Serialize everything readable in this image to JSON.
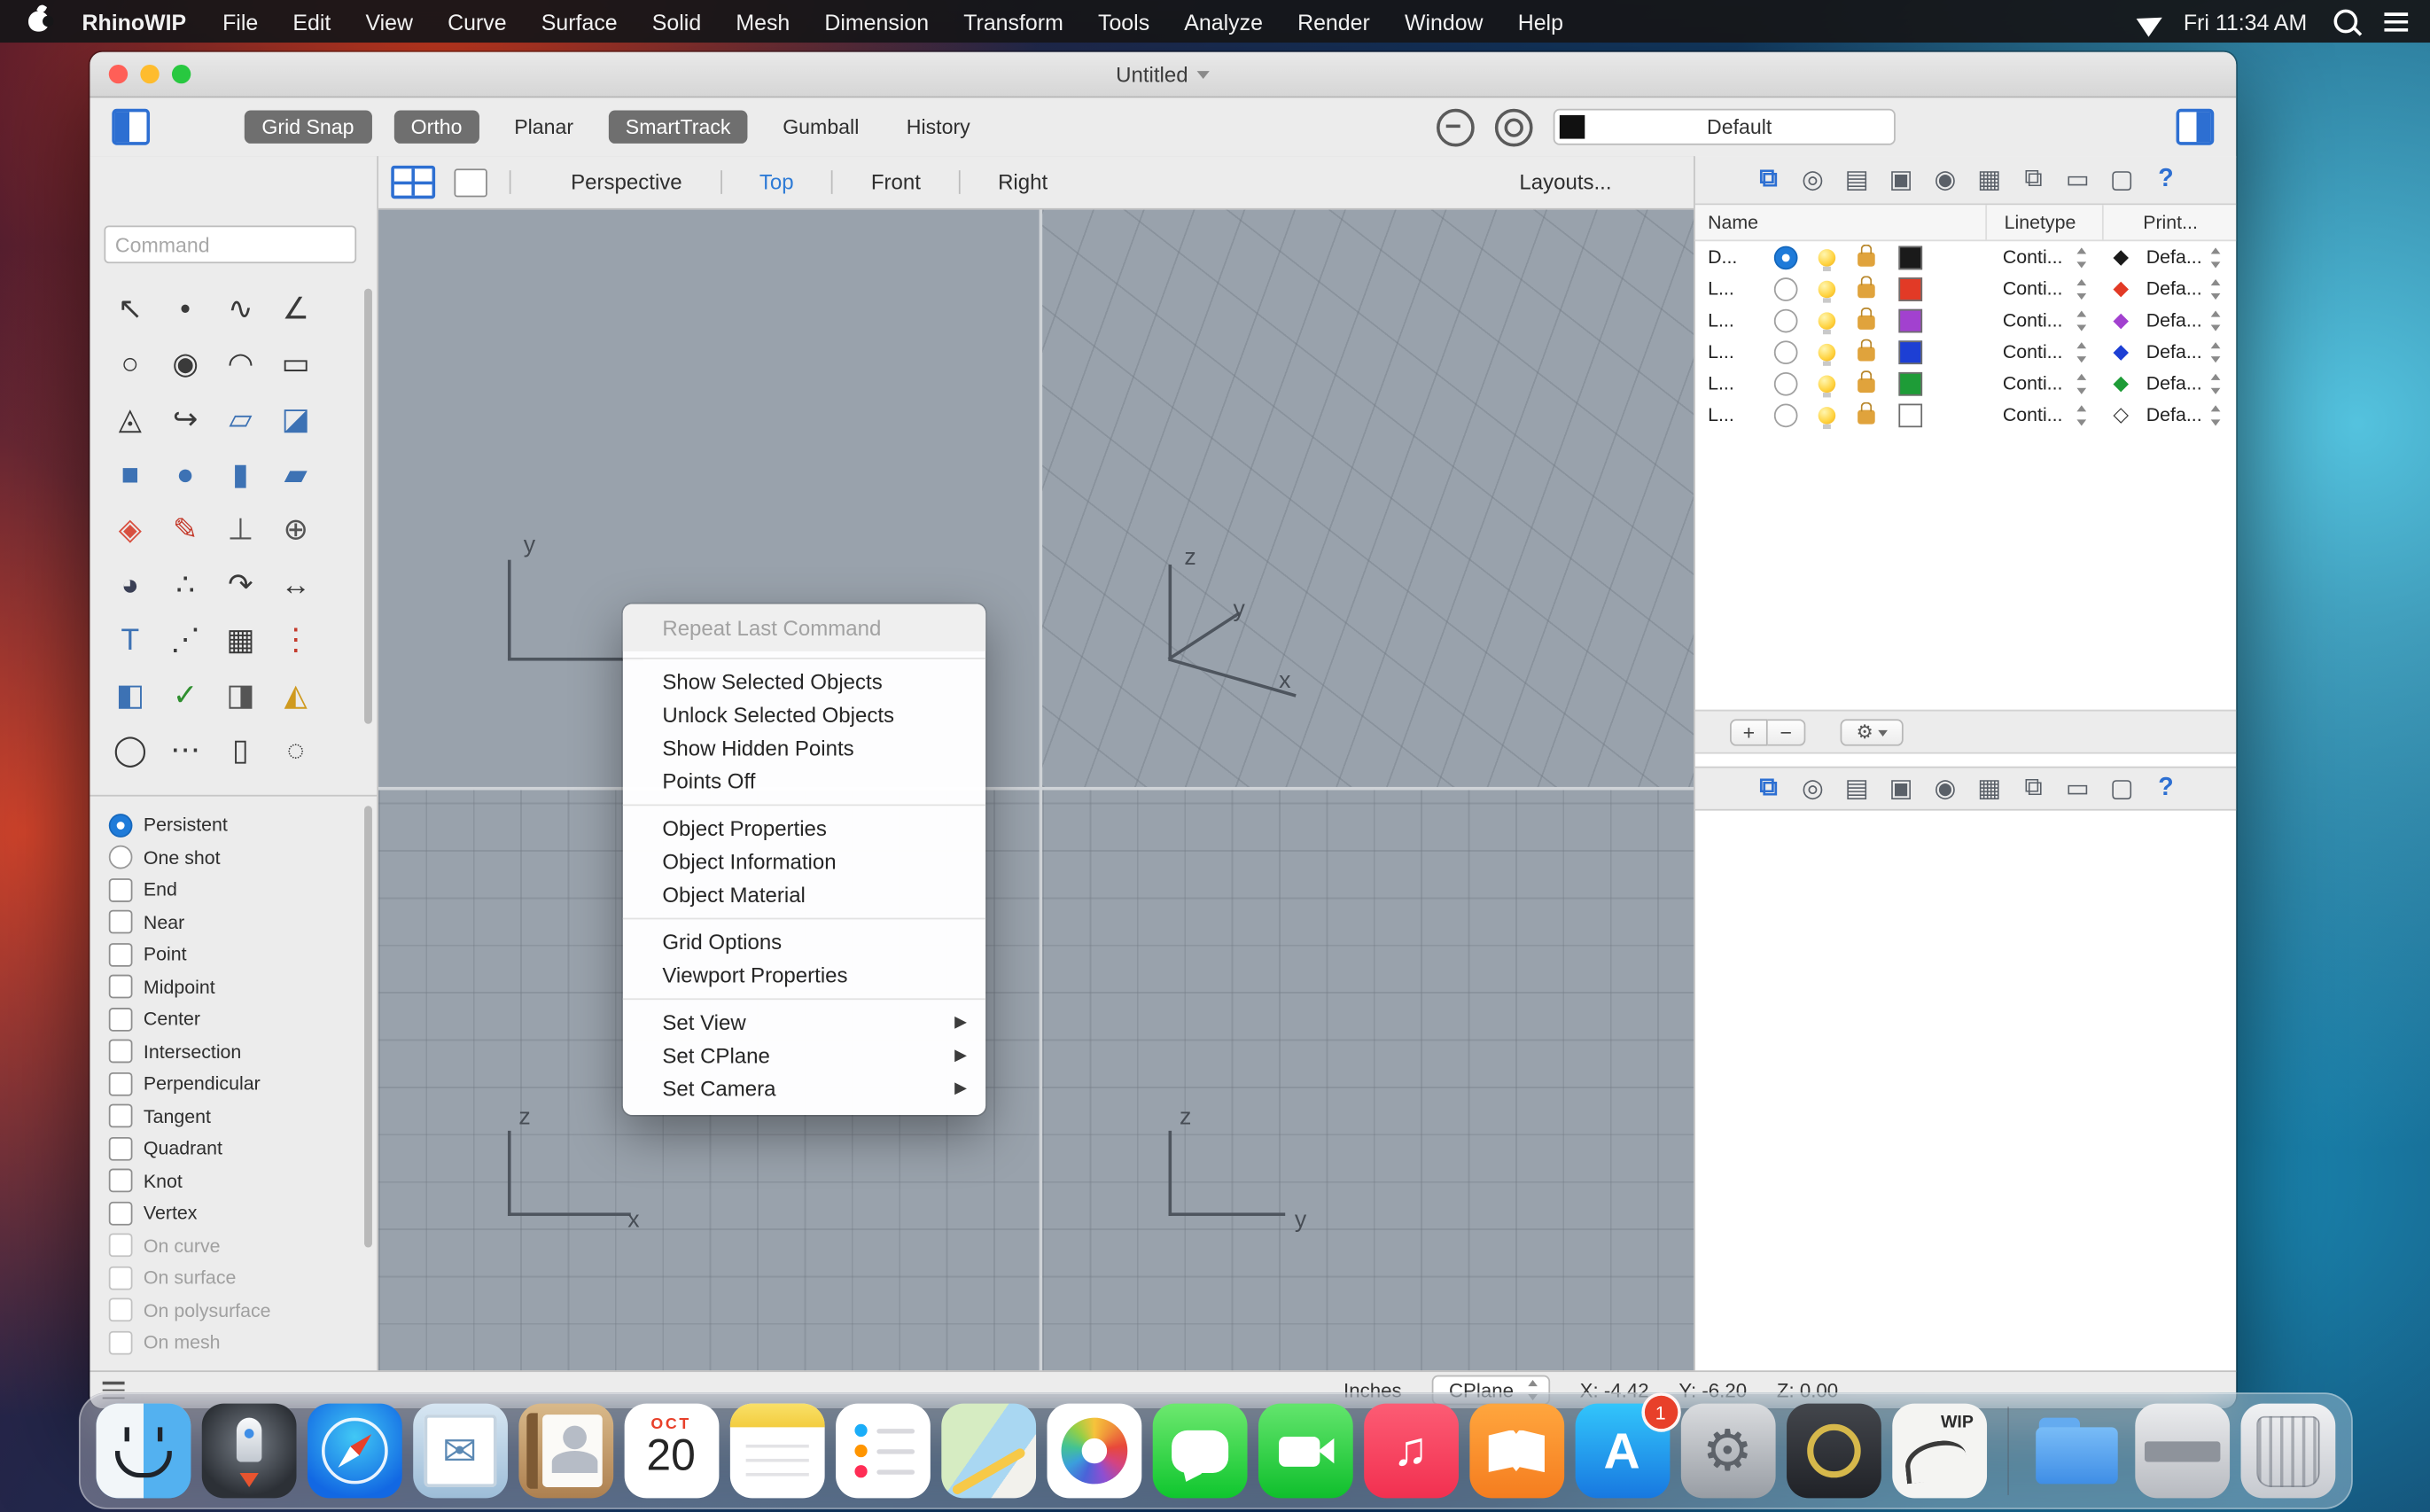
{
  "colors": {
    "accent_blue": "#2e7bd6",
    "viewport_bg": "#99a2ac",
    "menu_bar_bg": "#161618",
    "active_button_bg": "#6f6f6f"
  },
  "menu_bar": {
    "app_name": "RhinoWIP",
    "items": [
      "File",
      "Edit",
      "View",
      "Curve",
      "Surface",
      "Solid",
      "Mesh",
      "Dimension",
      "Transform",
      "Tools",
      "Analyze",
      "Render",
      "Window",
      "Help"
    ],
    "clock": "Fri 11:34 AM"
  },
  "window": {
    "title": "Untitled",
    "toolbar": {
      "buttons": [
        {
          "label": "Grid Snap",
          "active": true
        },
        {
          "label": "Ortho",
          "active": true
        },
        {
          "label": "Planar",
          "active": false
        },
        {
          "label": "SmartTrack",
          "active": true
        },
        {
          "label": "Gumball",
          "active": false
        },
        {
          "label": "History",
          "active": false
        }
      ],
      "layer_dropdown": "Default"
    },
    "viewport_bar": {
      "tabs": [
        {
          "label": "Perspective",
          "active": false
        },
        {
          "label": "Top",
          "active": true
        },
        {
          "label": "Front",
          "active": false
        },
        {
          "label": "Right",
          "active": false
        }
      ],
      "layouts_label": "Layouts..."
    },
    "command_input": {
      "placeholder": "Command"
    },
    "tools": [
      {
        "glyph": "↖",
        "color": "#3a3a3a"
      },
      {
        "glyph": "•",
        "color": "#3a3a3a"
      },
      {
        "glyph": "∿",
        "color": "#3a3a3a"
      },
      {
        "glyph": "∠",
        "color": "#3a3a3a"
      },
      {
        "glyph": "○",
        "color": "#3a3a3a"
      },
      {
        "glyph": "◉",
        "color": "#3a3a3a"
      },
      {
        "glyph": "◠",
        "color": "#3a3a3a"
      },
      {
        "glyph": "▭",
        "color": "#3a3a3a"
      },
      {
        "glyph": "◬",
        "color": "#3a3a3a"
      },
      {
        "glyph": "↪",
        "color": "#3a3a3a"
      },
      {
        "glyph": "▱",
        "color": "#3d72b4"
      },
      {
        "glyph": "◪",
        "color": "#3d72b4"
      },
      {
        "glyph": "■",
        "color": "#3d72b4"
      },
      {
        "glyph": "●",
        "color": "#3d72b4"
      },
      {
        "glyph": "▮",
        "color": "#3d72b4"
      },
      {
        "glyph": "▰",
        "color": "#3d72b4"
      },
      {
        "glyph": "◈",
        "color": "#d85040"
      },
      {
        "glyph": "✎",
        "color": "#c43b2c"
      },
      {
        "glyph": "⊥",
        "color": "#555555"
      },
      {
        "glyph": "⊕",
        "color": "#555555"
      },
      {
        "glyph": "◕",
        "color": "#3a3f55"
      },
      {
        "glyph": "∴",
        "color": "#3a3a3a"
      },
      {
        "glyph": "↷",
        "color": "#3a3a3a"
      },
      {
        "glyph": "↔",
        "color": "#3a3a3a"
      },
      {
        "glyph": "T",
        "color": "#3d72b4"
      },
      {
        "glyph": "⋰",
        "color": "#3a3a3a"
      },
      {
        "glyph": "▦",
        "color": "#3a3a3a"
      },
      {
        "glyph": "⋮",
        "color": "#c43b2c"
      },
      {
        "glyph": "◧",
        "color": "#3d72b4"
      },
      {
        "glyph": "✓",
        "color": "#2f8f2f"
      },
      {
        "glyph": "◨",
        "color": "#555555"
      },
      {
        "glyph": "◭",
        "color": "#cf9a1f"
      },
      {
        "glyph": "◯",
        "color": "#3a3a3a"
      },
      {
        "glyph": "⋯",
        "color": "#3a3a3a"
      },
      {
        "glyph": "▯",
        "color": "#3a3a3a"
      },
      {
        "glyph": "◌",
        "color": "#3a3a3a"
      },
      {
        "glyph": "⊙",
        "color": "#3a3a3a"
      },
      {
        "glyph": "∷",
        "color": "#3a3a3a"
      },
      {
        "glyph": "▫",
        "color": "#3a3a3a"
      },
      {
        "glyph": "◡",
        "color": "#3a3a3a"
      }
    ],
    "osnap": {
      "modes": [
        {
          "label": "Persistent",
          "selected": true
        },
        {
          "label": "One shot",
          "selected": false
        }
      ],
      "snaps": [
        {
          "label": "End",
          "disabled": false
        },
        {
          "label": "Near",
          "disabled": false
        },
        {
          "label": "Point",
          "disabled": false
        },
        {
          "label": "Midpoint",
          "disabled": false
        },
        {
          "label": "Center",
          "disabled": false
        },
        {
          "label": "Intersection",
          "disabled": false
        },
        {
          "label": "Perpendicular",
          "disabled": false
        },
        {
          "label": "Tangent",
          "disabled": false
        },
        {
          "label": "Quadrant",
          "disabled": false
        },
        {
          "label": "Knot",
          "disabled": false
        },
        {
          "label": "Vertex",
          "disabled": false
        },
        {
          "label": "On curve",
          "disabled": true
        },
        {
          "label": "On surface",
          "disabled": true
        },
        {
          "label": "On polysurface",
          "disabled": true
        },
        {
          "label": "On mesh",
          "disabled": true
        }
      ]
    },
    "context_menu": {
      "submenu_arrow": "▶",
      "items": [
        {
          "type": "item",
          "label": "Repeat Last Command",
          "disabled": true
        },
        {
          "type": "divider"
        },
        {
          "type": "item",
          "label": "Show Selected Objects"
        },
        {
          "type": "item",
          "label": "Unlock Selected Objects"
        },
        {
          "type": "item",
          "label": "Show Hidden Points"
        },
        {
          "type": "item",
          "label": "Points Off"
        },
        {
          "type": "divider"
        },
        {
          "type": "item",
          "label": "Object Properties"
        },
        {
          "type": "item",
          "label": "Object Information"
        },
        {
          "type": "item",
          "label": "Object Material"
        },
        {
          "type": "divider"
        },
        {
          "type": "item",
          "label": "Grid Options"
        },
        {
          "type": "item",
          "label": "Viewport Properties"
        },
        {
          "type": "divider"
        },
        {
          "type": "item",
          "label": "Set View",
          "submenu": true
        },
        {
          "type": "item",
          "label": "Set CPlane",
          "submenu": true
        },
        {
          "type": "item",
          "label": "Set Camera",
          "submenu": true
        }
      ]
    },
    "viewports": {
      "top": {
        "y_label": "y"
      },
      "perspective": {
        "z_label": "z",
        "y_label": "y",
        "x_label": "x"
      },
      "front": {
        "z_label": "z",
        "x_label": "x"
      },
      "right": {
        "z_label": "z",
        "y_label": "y"
      }
    },
    "panel_icons": [
      {
        "glyph": "⧉",
        "name": "layers-panel",
        "accent": true
      },
      {
        "glyph": "◎",
        "name": "properties-panel",
        "accent": false
      },
      {
        "glyph": "▤",
        "name": "notes-panel",
        "accent": false
      },
      {
        "glyph": "▣",
        "name": "materials-panel",
        "accent": false
      },
      {
        "glyph": "◉",
        "name": "camera-panel",
        "accent": false
      },
      {
        "glyph": "▦",
        "name": "grid-panel",
        "accent": false
      },
      {
        "glyph": "⧉",
        "name": "pages-panel",
        "accent": false
      },
      {
        "glyph": "▭",
        "name": "layout-panel",
        "accent": false
      },
      {
        "glyph": "▢",
        "name": "display-panel",
        "accent": false
      },
      {
        "glyph": "?",
        "name": "help-panel",
        "accent": true
      }
    ],
    "layers_panel": {
      "headers": [
        "Name",
        "Linetype",
        "Print..."
      ],
      "add_label": "+",
      "remove_label": "−",
      "gear_glyph": "⚙",
      "rows": [
        {
          "name": "D...",
          "current": true,
          "color": "#1a1a1a",
          "linetype": "Conti...",
          "diamond": "◆",
          "diamond_color": "#1a1a1a",
          "print": "Defa..."
        },
        {
          "name": "L...",
          "current": false,
          "color": "#e23a26",
          "linetype": "Conti...",
          "diamond": "◆",
          "diamond_color": "#e23a26",
          "print": "Defa..."
        },
        {
          "name": "L...",
          "current": false,
          "color": "#a241cf",
          "linetype": "Conti...",
          "diamond": "◆",
          "diamond_color": "#a241cf",
          "print": "Defa..."
        },
        {
          "name": "L...",
          "current": false,
          "color": "#1d3fd4",
          "linetype": "Conti...",
          "diamond": "◆",
          "diamond_color": "#1d3fd4",
          "print": "Defa..."
        },
        {
          "name": "L...",
          "current": false,
          "color": "#1e9c37",
          "linetype": "Conti...",
          "diamond": "◆",
          "diamond_color": "#1e9c37",
          "print": "Defa..."
        },
        {
          "name": "L...",
          "current": false,
          "color": "#ffffff",
          "linetype": "Conti...",
          "diamond": "◇",
          "diamond_color": "#3a3a3a",
          "print": "Defa..."
        }
      ]
    },
    "status_bar": {
      "units": "Inches",
      "cplane": "CPlane",
      "x": "X: -4.42",
      "y": "Y: -6.20",
      "z": "Z: 0.00"
    }
  },
  "dock": {
    "apps": [
      {
        "id": "finder",
        "parts": [
          {
            "cls": "finder-face",
            "name": "finder-face"
          }
        ]
      },
      {
        "id": "launchpad",
        "parts": [
          {
            "cls": "rocket",
            "name": "rocket"
          },
          {
            "cls": "flame",
            "name": "rocket-flame"
          }
        ]
      },
      {
        "id": "safari",
        "parts": [
          {
            "cls": "saf-ring",
            "name": "compass-ring"
          },
          {
            "cls": "saf-needle",
            "name": "compass-needle"
          }
        ]
      },
      {
        "id": "mail",
        "parts": [
          {
            "cls": "stamp",
            "name": "stamp"
          },
          {
            "cls": "mail-glyph",
            "name": "envelope-icon",
            "text": "✉"
          }
        ]
      },
      {
        "id": "contacts",
        "parts": [
          {
            "cls": "card",
            "name": "contact-card"
          },
          {
            "cls": "silhouette",
            "name": "contact-silhouette"
          }
        ]
      },
      {
        "id": "calendar",
        "parts": [
          {
            "cls": "cal-m",
            "name": "calendar-month",
            "text": "OCT"
          },
          {
            "cls": "cal-d",
            "name": "calendar-day",
            "text": "20"
          }
        ]
      },
      {
        "id": "notes",
        "parts": [
          {
            "cls": "notes-top",
            "name": "notes-header"
          }
        ]
      },
      {
        "id": "reminders",
        "parts": [
          {
            "cls": "rem-lines",
            "name": "reminder-lines"
          }
        ]
      },
      {
        "id": "maps",
        "parts": [
          {
            "cls": "road",
            "name": "road"
          }
        ]
      },
      {
        "id": "photos",
        "parts": [
          {
            "cls": "pinwheel",
            "name": "pinwheel"
          }
        ]
      },
      {
        "id": "messages",
        "parts": [
          {
            "cls": "bubble",
            "name": "speech-bubble"
          }
        ]
      },
      {
        "id": "facetime",
        "parts": [
          {
            "cls": "cam",
            "name": "camera-body"
          },
          {
            "cls": "cam-lens",
            "name": "camera-lens"
          }
        ]
      },
      {
        "id": "music",
        "parts": [
          {
            "cls": "note",
            "name": "music-note",
            "text": "♫"
          }
        ]
      },
      {
        "id": "books",
        "parts": [
          {
            "cls": "book",
            "name": "open-book"
          }
        ]
      },
      {
        "id": "app-store",
        "parts": [
          {
            "cls": "as-letter",
            "name": "app-store-letter",
            "text": "A"
          },
          {
            "cls": "badge",
            "name": "notification-badge",
            "text": "1"
          }
        ]
      },
      {
        "id": "system-preferences",
        "parts": [
          {
            "cls": "gear-g",
            "name": "gear-icon",
            "text": "⚙"
          }
        ]
      },
      {
        "id": "utility",
        "parts": [
          {
            "cls": "util-ring",
            "name": "ring"
          }
        ]
      },
      {
        "id": "rhino-wip",
        "parts": [
          {
            "cls": "wip-label",
            "name": "wip-label",
            "text": "WIP"
          },
          {
            "cls": "rhino-scribble",
            "name": "rhino-sketch"
          }
        ]
      },
      {
        "id": "separator",
        "separator": true
      },
      {
        "id": "folder",
        "parts": [
          {
            "cls": "folder-tab",
            "name": "folder-tab"
          },
          {
            "cls": "folder-body",
            "name": "folder-body"
          }
        ]
      },
      {
        "id": "disk",
        "parts": [
          {
            "cls": "disk-band",
            "name": "disk-band"
          }
        ]
      },
      {
        "id": "trash",
        "parts": [
          {
            "cls": "trash-mesh",
            "name": "trash-mesh"
          }
        ]
      }
    ]
  }
}
